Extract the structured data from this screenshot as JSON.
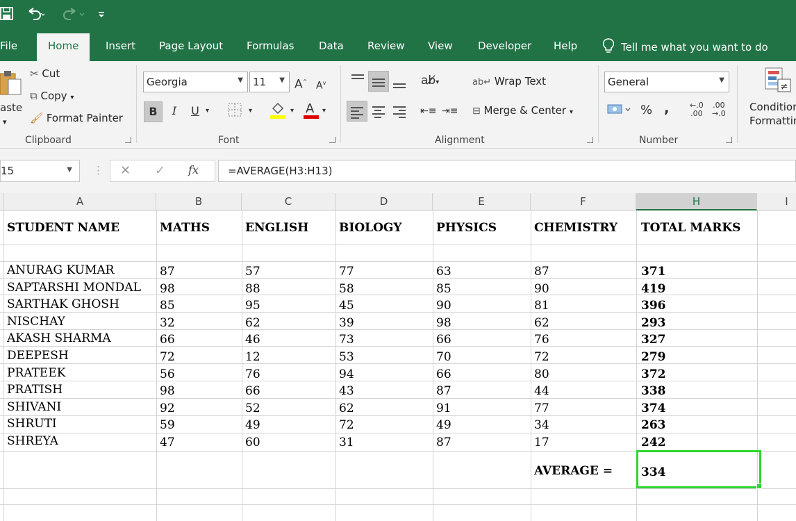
{
  "quick_access": {
    "save_icon": "save-icon",
    "undo_icon": "undo-icon",
    "redo_icon": "redo-icon",
    "customize_icon": "customize-qat-icon"
  },
  "tabs": [
    {
      "id": "file",
      "label": "File"
    },
    {
      "id": "home",
      "label": "Home",
      "active": true
    },
    {
      "id": "insert",
      "label": "Insert"
    },
    {
      "id": "page-layout",
      "label": "Page Layout"
    },
    {
      "id": "formulas",
      "label": "Formulas"
    },
    {
      "id": "data",
      "label": "Data"
    },
    {
      "id": "review",
      "label": "Review"
    },
    {
      "id": "view",
      "label": "View"
    },
    {
      "id": "developer",
      "label": "Developer"
    },
    {
      "id": "help",
      "label": "Help"
    }
  ],
  "tell_me": "Tell me what you want to do",
  "ribbon": {
    "clipboard": {
      "label": "Clipboard",
      "paste": "aste",
      "cut": "Cut",
      "copy": "Copy",
      "format_painter": "Format Painter"
    },
    "font": {
      "label": "Font",
      "name": "Georgia",
      "size": "11",
      "bold": "B",
      "italic": "I",
      "underline": "U"
    },
    "alignment": {
      "label": "Alignment",
      "wrap_text": "Wrap Text",
      "merge_center": "Merge & Center"
    },
    "number": {
      "label": "Number",
      "format": "General",
      "percent": "%",
      "comma": ","
    },
    "conditional": {
      "line1": "Condition",
      "line2": "Formattin"
    }
  },
  "formula_bar": {
    "name_box": "15",
    "formula": "=AVERAGE(H3:H13)",
    "fx": "fx"
  },
  "columns": [
    "A",
    "B",
    "C",
    "D",
    "E",
    "F",
    "H",
    "I"
  ],
  "headers": [
    "STUDENT NAME",
    "MATHS",
    "ENGLISH",
    "BIOLOGY",
    "PHYSICS",
    "CHEMISTRY",
    "TOTAL MARKS"
  ],
  "rows": [
    [
      "ANURAG KUMAR",
      "87",
      "57",
      "77",
      "63",
      "87",
      "371"
    ],
    [
      "SAPTARSHI MONDAL",
      "98",
      "88",
      "58",
      "85",
      "90",
      "419"
    ],
    [
      "SARTHAK GHOSH",
      "85",
      "95",
      "45",
      "90",
      "81",
      "396"
    ],
    [
      "NISCHAY",
      "32",
      "62",
      "39",
      "98",
      "62",
      "293"
    ],
    [
      "AKASH SHARMA",
      "66",
      "46",
      "73",
      "66",
      "76",
      "327"
    ],
    [
      "DEEPESH",
      "72",
      "12",
      "53",
      "70",
      "72",
      "279"
    ],
    [
      "PRATEEK",
      "56",
      "76",
      "94",
      "66",
      "80",
      "372"
    ],
    [
      "PRATISH",
      "98",
      "66",
      "43",
      "87",
      "44",
      "338"
    ],
    [
      "SHIVANI",
      "92",
      "52",
      "62",
      "91",
      "77",
      "374"
    ],
    [
      "SHRUTI",
      "59",
      "49",
      "72",
      "49",
      "34",
      "263"
    ],
    [
      "SHREYA",
      "47",
      "60",
      "31",
      "87",
      "17",
      "242"
    ]
  ],
  "average": {
    "label": "AVERAGE =",
    "value": "334"
  },
  "colors": {
    "excel_green": "#217346",
    "selection": "#2ed62e"
  }
}
